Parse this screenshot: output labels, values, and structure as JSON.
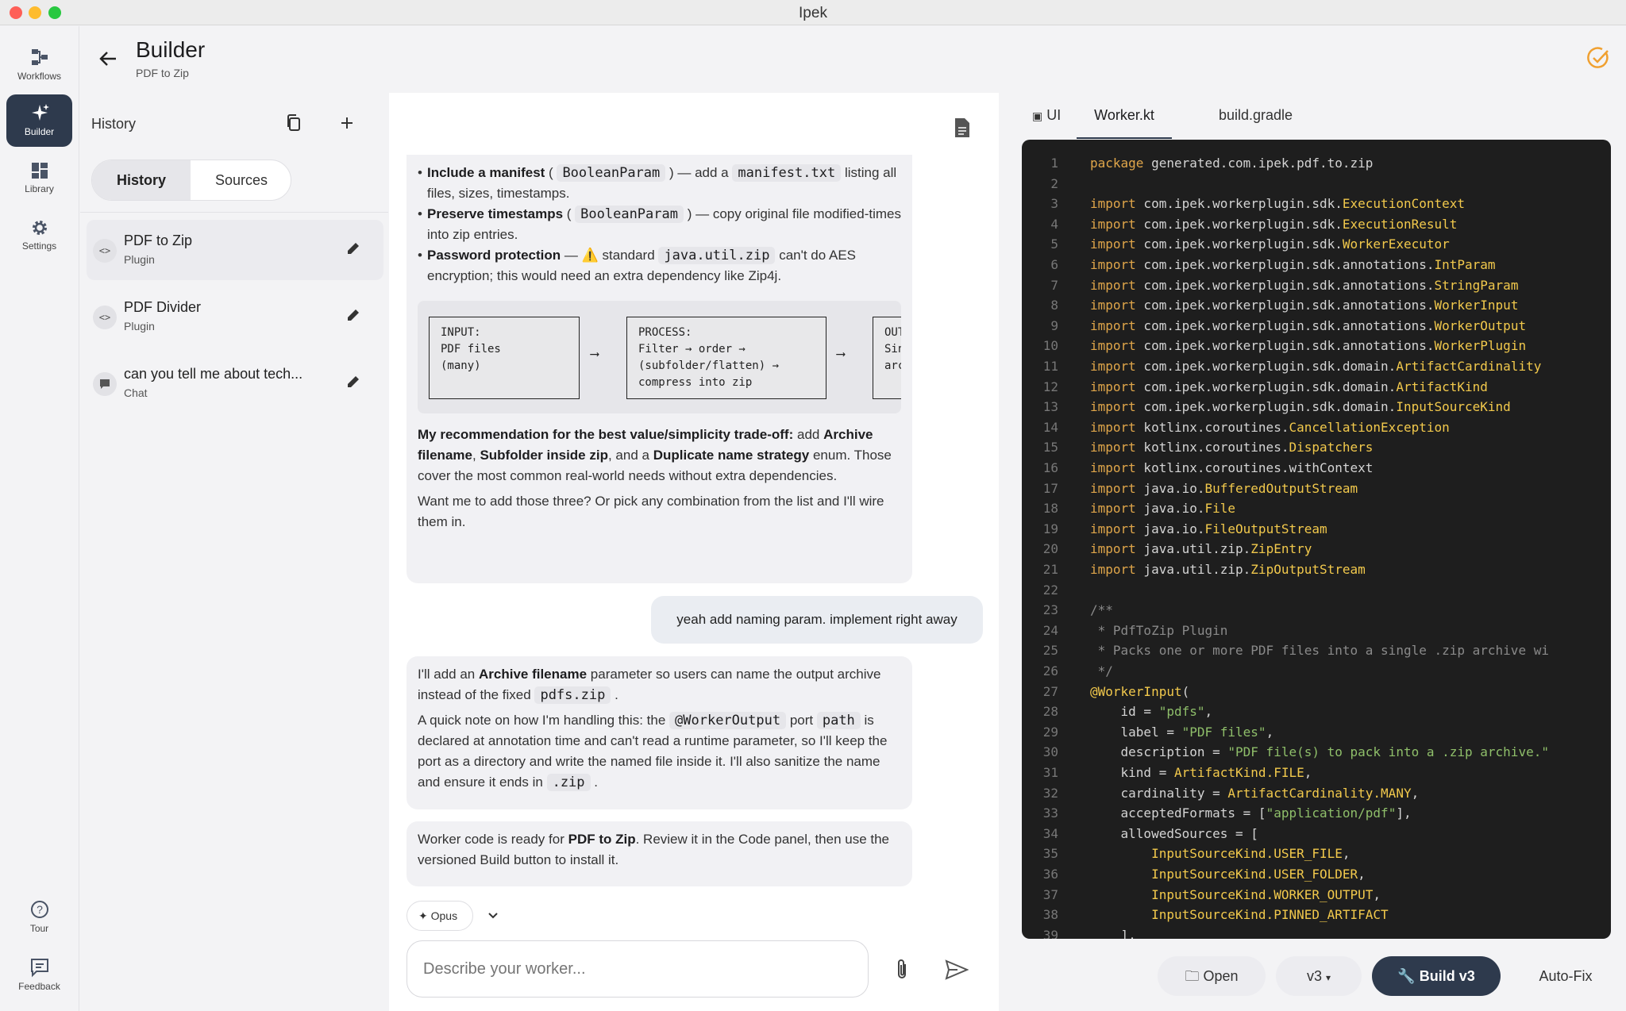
{
  "window": {
    "title": "Ipek"
  },
  "rail": {
    "items": [
      {
        "label": "Workflows"
      },
      {
        "label": "Builder"
      },
      {
        "label": "Library"
      },
      {
        "label": "Settings"
      },
      {
        "label": "Tour"
      },
      {
        "label": "Feedback"
      }
    ]
  },
  "header": {
    "title": "Builder",
    "subtitle": "PDF to Zip"
  },
  "history": {
    "title": "History",
    "tabs": [
      "History",
      "Sources"
    ],
    "items": [
      {
        "name": "PDF to Zip",
        "type": "Plugin"
      },
      {
        "name": "PDF Divider",
        "type": "Plugin"
      },
      {
        "name": "can you tell me about tech...",
        "type": "Chat"
      }
    ]
  },
  "chat": {
    "bubble1": {
      "b1_bold": "Include a manifest",
      "b1_code1": "BooleanParam",
      "b1_mid": "— add a",
      "b1_code2": "manifest.txt",
      "b1_rest": "listing all files, sizes, timestamps.",
      "b2_bold": "Preserve timestamps",
      "b2_code1": "BooleanParam",
      "b2_rest": "— copy original file modified-times into zip entries.",
      "b3_bold": "Password protection",
      "b3_mid": "— ⚠️ standard",
      "b3_code1": "java.util.zip",
      "b3_rest": "can't do AES encryption; this would need an extra dependency like Zip4j.",
      "flow_input": "INPUT:\nPDF files\n(many)",
      "flow_process": "PROCESS:\nFilter → order →\n(subfolder/flatten) →\ncompress into zip",
      "flow_output": "OUTPUT:\nSingle\narchive",
      "rec_bold1": "My recommendation for the best value/simplicity trade-off:",
      "rec_t1": "add",
      "rec_bold2": "Archive filename",
      "rec_t2": ",",
      "rec_bold3": "Subfolder inside zip",
      "rec_t3": ", and a",
      "rec_bold4": "Duplicate name strategy",
      "rec_t4": "enum. Those cover the most common real-world needs without extra dependencies.",
      "ask": "Want me to add those three? Or pick any combination from the list and I'll wire them in."
    },
    "user_msg": "yeah add naming param. implement right away",
    "bubble2": {
      "p1_a": "I'll add an",
      "p1_bold": "Archive filename",
      "p1_b": "parameter so users can name the output archive instead of the fixed",
      "p1_code": "pdfs.zip",
      "p1_c": ".",
      "p2_a": "A quick note on how I'm handling this: the",
      "p2_code1": "@WorkerOutput",
      "p2_b": "port",
      "p2_code2": "path",
      "p2_c": "is declared at annotation time and can't read a runtime parameter, so I'll keep the port as a directory and write the named file inside it. I'll also sanitize the name and ensure it ends in",
      "p2_code3": ".zip",
      "p2_d": "."
    },
    "bubble3": {
      "a": "Worker code is ready for",
      "bold": "PDF to Zip",
      "b": ". Review it in the Code panel, then use the versioned Build button to install it."
    },
    "model": "Opus",
    "input_placeholder": "Describe your worker..."
  },
  "code_panel": {
    "tabs": [
      "UI",
      "Worker.kt",
      "build.gradle"
    ],
    "buttons": {
      "open": "Open",
      "version": "v3",
      "build": "Build v3",
      "autofix": "Auto-Fix"
    }
  },
  "code_lines": [
    "<span class=\"kw\">package</span> generated.com.ipek.pdf.to.zip",
    "",
    "<span class=\"kw\">import</span> com.ipek.workerplugin.sdk.<span class=\"ty\">ExecutionContext</span>",
    "<span class=\"kw\">import</span> com.ipek.workerplugin.sdk.<span class=\"ty\">ExecutionResult</span>",
    "<span class=\"kw\">import</span> com.ipek.workerplugin.sdk.<span class=\"ty\">WorkerExecutor</span>",
    "<span class=\"kw\">import</span> com.ipek.workerplugin.sdk.annotations.<span class=\"ty\">IntParam</span>",
    "<span class=\"kw\">import</span> com.ipek.workerplugin.sdk.annotations.<span class=\"ty\">StringParam</span>",
    "<span class=\"kw\">import</span> com.ipek.workerplugin.sdk.annotations.<span class=\"ty\">WorkerInput</span>",
    "<span class=\"kw\">import</span> com.ipek.workerplugin.sdk.annotations.<span class=\"ty\">WorkerOutput</span>",
    "<span class=\"kw\">import</span> com.ipek.workerplugin.sdk.annotations.<span class=\"ty\">WorkerPlugin</span>",
    "<span class=\"kw\">import</span> com.ipek.workerplugin.sdk.domain.<span class=\"ty\">ArtifactCardinality</span>",
    "<span class=\"kw\">import</span> com.ipek.workerplugin.sdk.domain.<span class=\"ty\">ArtifactKind</span>",
    "<span class=\"kw\">import</span> com.ipek.workerplugin.sdk.domain.<span class=\"ty\">InputSourceKind</span>",
    "<span class=\"kw\">import</span> kotlinx.coroutines.<span class=\"ty\">CancellationException</span>",
    "<span class=\"kw\">import</span> kotlinx.coroutines.<span class=\"ty\">Dispatchers</span>",
    "<span class=\"kw\">import</span> kotlinx.coroutines.withContext",
    "<span class=\"kw\">import</span> java.io.<span class=\"ty\">BufferedOutputStream</span>",
    "<span class=\"kw\">import</span> java.io.<span class=\"ty\">File</span>",
    "<span class=\"kw\">import</span> java.io.<span class=\"ty\">FileOutputStream</span>",
    "<span class=\"kw\">import</span> java.util.zip.<span class=\"ty\">ZipEntry</span>",
    "<span class=\"kw\">import</span> java.util.zip.<span class=\"ty\">ZipOutputStream</span>",
    "",
    "<span class=\"cm\">/**</span>",
    "<span class=\"cm\"> * PdfToZip Plugin</span>",
    "<span class=\"cm\"> * Packs one or more PDF files into a single .zip archive wi</span>",
    "<span class=\"cm\"> */</span>",
    "<span class=\"ty\">@WorkerInput</span>(",
    "    id = <span class=\"str\">\"pdfs\"</span>,",
    "    label = <span class=\"str\">\"PDF files\"</span>,",
    "    description = <span class=\"str\">\"PDF file(s) to pack into a .zip archive.\"</span>",
    "    kind = <span class=\"ty\">ArtifactKind.FILE</span>,",
    "    cardinality = <span class=\"ty\">ArtifactCardinality.MANY</span>,",
    "    acceptedFormats = [<span class=\"str\">\"application/pdf\"</span>],",
    "    allowedSources = [",
    "        <span class=\"ty\">InputSourceKind.USER_FILE</span>,",
    "        <span class=\"ty\">InputSourceKind.USER_FOLDER</span>,",
    "        <span class=\"ty\">InputSourceKind.WORKER_OUTPUT</span>,",
    "        <span class=\"ty\">InputSourceKind.PINNED_ARTIFACT</span>",
    "    ],"
  ]
}
